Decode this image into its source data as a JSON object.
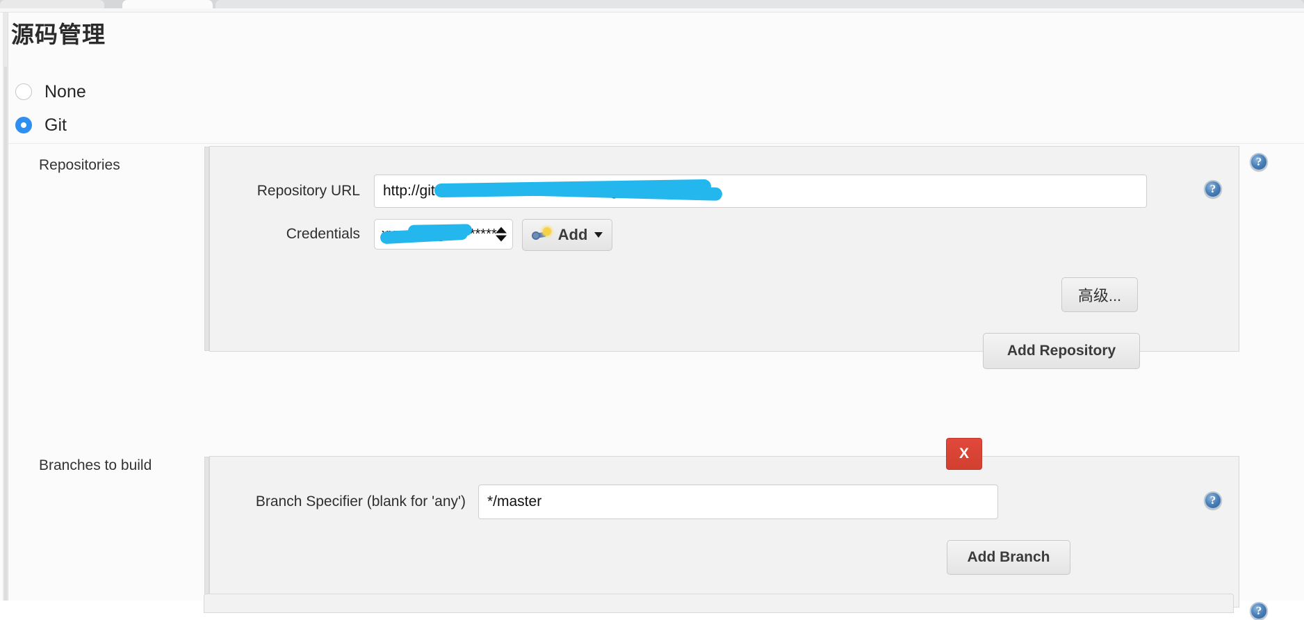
{
  "browser": {
    "tabs": [
      "",
      "",
      ""
    ]
  },
  "page": {
    "title": "源码管理"
  },
  "scm_choice": {
    "options": [
      {
        "label": "None",
        "selected": false
      },
      {
        "label": "Git",
        "selected": true
      }
    ]
  },
  "repositories": {
    "section_label": "Repositories",
    "repository_url": {
      "label": "Repository URL",
      "value": "http://git.cloudmin.cn/tools/xxx-tool.git",
      "redacted": true,
      "visible_prefix": "http://"
    },
    "credentials": {
      "label": "Credentials",
      "value": "xxx-zhangbo/******",
      "redacted": true,
      "visible_suffix": "/******"
    },
    "add_credentials_button": {
      "label": "Add",
      "icon": "key-icon",
      "has_dropdown": true
    },
    "advanced_button": "高级...",
    "add_repository_button": "Add Repository",
    "help_label": "?"
  },
  "branches": {
    "section_label": "Branches to build",
    "branch_specifier": {
      "label": "Branch Specifier (blank for 'any')",
      "value": "*/master"
    },
    "delete_button": "X",
    "add_branch_button": "Add Branch",
    "help_label": "?"
  },
  "colors": {
    "accent_blue": "#2f8ff0",
    "marker_blue": "#23b7ee",
    "delete_red": "#d2402f",
    "help_blue": "#4a80b8",
    "panel_bg": "#f2f2f2",
    "page_bg": "#fbfbfb"
  }
}
